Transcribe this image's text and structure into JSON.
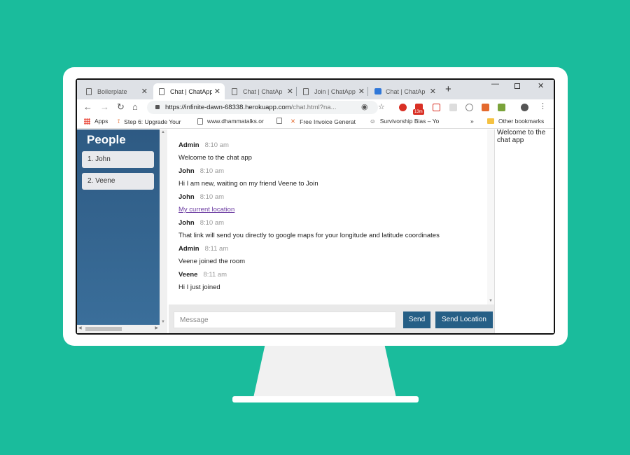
{
  "tabs": [
    {
      "title": "Boilerplate",
      "active": false,
      "icon": "doc-icon"
    },
    {
      "title": "Chat | ChatApp",
      "active": true,
      "icon": "doc-icon"
    },
    {
      "title": "Chat | ChatApp",
      "active": false,
      "icon": "doc-icon"
    },
    {
      "title": "Join | ChatApp",
      "active": false,
      "icon": "doc-icon"
    },
    {
      "title": "Chat | ChatApp",
      "active": false,
      "icon": "chatapp-favicon"
    }
  ],
  "address": {
    "host": "https://infinite-dawn-68338.herokuapp.com",
    "path": "/chat.html?na..."
  },
  "extension_badge": "13m",
  "bookmarks": [
    {
      "label": "Apps"
    },
    {
      "label": "Step 6: Upgrade Your"
    },
    {
      "label": "www.dhammatalks.or"
    },
    {
      "label": ""
    },
    {
      "label": "Free Invoice Generat"
    },
    {
      "label": "Survivorship Bias – Yo"
    },
    {
      "label": "Other bookmarks"
    }
  ],
  "sidebar": {
    "title": "People",
    "people": [
      "1. John",
      "2. Veene"
    ]
  },
  "messages": [
    {
      "from": "Admin",
      "time": "8:10 am",
      "text": "Welcome to the chat app",
      "is_link": false
    },
    {
      "from": "John",
      "time": "8:10 am",
      "text": "Hi I am new, waiting on my friend Veene to Join",
      "is_link": false
    },
    {
      "from": "John",
      "time": "8:10 am",
      "text": "My current location",
      "is_link": true
    },
    {
      "from": "John",
      "time": "8:10 am",
      "text": "That link will send you directly to google maps for your longitude and latitude coordinates",
      "is_link": false
    },
    {
      "from": "Admin",
      "time": "8:11 am",
      "text": "Veene joined the room",
      "is_link": false
    },
    {
      "from": "Veene",
      "time": "8:11 am",
      "text": "Hi I just joined",
      "is_link": false
    }
  ],
  "composer": {
    "placeholder": "Message",
    "send_label": "Send",
    "send_location_label": "Send Location"
  },
  "right_pane_text": "Welcome to the chat app",
  "colors": {
    "background": "#1ABC9C",
    "sidebar": "#2e5a83",
    "button": "#265f86"
  }
}
